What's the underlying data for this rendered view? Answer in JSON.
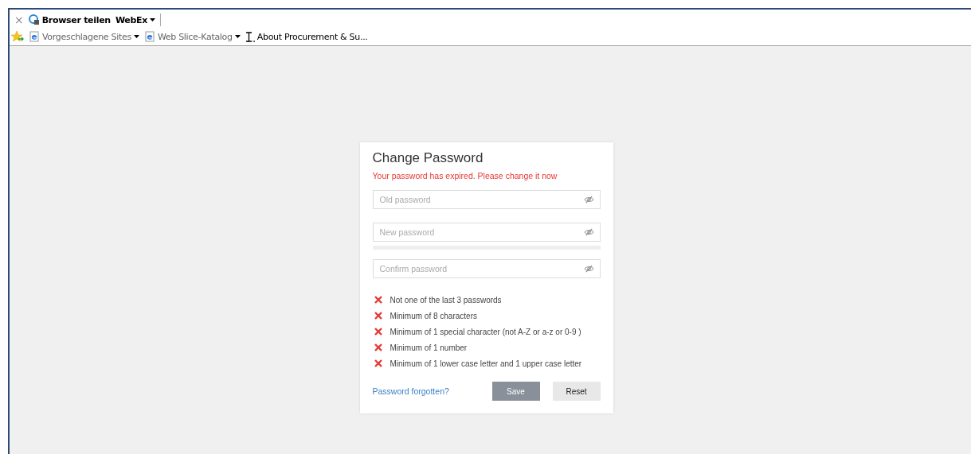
{
  "command_bar": {
    "items": [
      {
        "kind": "close",
        "label": "×"
      },
      {
        "kind": "share",
        "label": "Browser teilen"
      },
      {
        "kind": "menu",
        "label": "WebEx"
      }
    ]
  },
  "favorites_bar": {
    "items": [
      {
        "kind": "menu",
        "label": "Vorgeschlagene Sites"
      },
      {
        "kind": "menu",
        "label": "Web Slice-Katalog"
      },
      {
        "kind": "link",
        "label": "About Procurement & Su..."
      }
    ]
  },
  "dialog": {
    "title": "Change Password",
    "error": "Your password has expired. Please change it now",
    "fields": [
      {
        "placeholder": "Old password"
      },
      {
        "placeholder": "New password",
        "level": 0
      },
      {
        "placeholder": "Confirm password"
      }
    ],
    "rules": [
      {
        "text": "Not one of the last 3 passwords",
        "met": false
      },
      {
        "text": "Minimum of 8 characters",
        "met": false
      },
      {
        "text": "Minimum of 1 special character (not A-Z or a-z or 0-9 )",
        "met": false
      },
      {
        "text": "Minimum of 1 number",
        "met": false
      },
      {
        "text": "Minimum of 1 lower case letter and 1 upper case letter",
        "met": false
      }
    ],
    "forgot_link": "Password forgotten?",
    "buttons": [
      {
        "kind": "primary",
        "label": "Save",
        "disabled": true
      },
      {
        "kind": "secondary",
        "label": "Reset",
        "disabled": false
      }
    ]
  }
}
